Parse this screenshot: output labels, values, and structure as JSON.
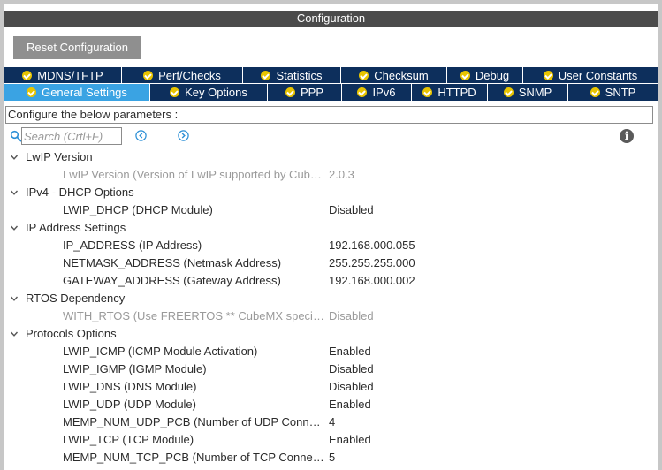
{
  "window": {
    "title": "Configuration"
  },
  "toolbar": {
    "reset_label": "Reset Configuration"
  },
  "tabs": {
    "row1": [
      {
        "label": "MDNS/TFTP"
      },
      {
        "label": "Perf/Checks"
      },
      {
        "label": "Statistics"
      },
      {
        "label": "Checksum"
      },
      {
        "label": "Debug"
      },
      {
        "label": "User Constants"
      }
    ],
    "row2": [
      {
        "label": "General Settings",
        "active": true
      },
      {
        "label": "Key Options"
      },
      {
        "label": "PPP"
      },
      {
        "label": "IPv6"
      },
      {
        "label": "HTTPD"
      },
      {
        "label": "SNMP"
      },
      {
        "label": "SNTP"
      }
    ]
  },
  "description": "Configure the below parameters :",
  "search": {
    "placeholder": "Search (Crtl+F)"
  },
  "groups": [
    {
      "label": "LwIP Version",
      "params": [
        {
          "name": "LwIP Version (Version of LwIP supported by CubeMX)",
          "value": "2.0.3",
          "disabled": true
        }
      ]
    },
    {
      "label": "IPv4 - DHCP Options",
      "params": [
        {
          "name": "LWIP_DHCP (DHCP Module)",
          "value": "Disabled"
        }
      ]
    },
    {
      "label": "IP Address Settings",
      "params": [
        {
          "name": "IP_ADDRESS (IP Address)",
          "value": "192.168.000.055"
        },
        {
          "name": "NETMASK_ADDRESS (Netmask Address)",
          "value": "255.255.255.000"
        },
        {
          "name": "GATEWAY_ADDRESS (Gateway Address)",
          "value": "192.168.000.002"
        }
      ]
    },
    {
      "label": "RTOS Dependency",
      "params": [
        {
          "name": "WITH_RTOS (Use FREERTOS ** CubeMX specific **)",
          "value": "Disabled",
          "disabled": true
        }
      ]
    },
    {
      "label": "Protocols Options",
      "params": [
        {
          "name": "LWIP_ICMP (ICMP Module Activation)",
          "value": "Enabled"
        },
        {
          "name": "LWIP_IGMP (IGMP Module)",
          "value": "Disabled"
        },
        {
          "name": "LWIP_DNS (DNS Module)",
          "value": "Disabled"
        },
        {
          "name": "LWIP_UDP (UDP Module)",
          "value": "Enabled"
        },
        {
          "name": "MEMP_NUM_UDP_PCB (Number of UDP Connections)",
          "value": "4"
        },
        {
          "name": "LWIP_TCP (TCP Module)",
          "value": "Enabled"
        },
        {
          "name": "MEMP_NUM_TCP_PCB (Number of TCP Connections)",
          "value": "5"
        }
      ]
    }
  ],
  "colors": {
    "tab_inactive": "#0d2f5c",
    "tab_active": "#3aa3e3",
    "check_icon": "#e8c400",
    "title_bar": "#4b4b4b",
    "nav_icon": "#2b8fd6"
  },
  "icons": {
    "search": "search-icon",
    "prev": "previous-arrow-icon",
    "next": "next-arrow-icon",
    "info": "info-icon",
    "expand": "chevron-down-icon",
    "tab_status": "check-circle-icon"
  }
}
